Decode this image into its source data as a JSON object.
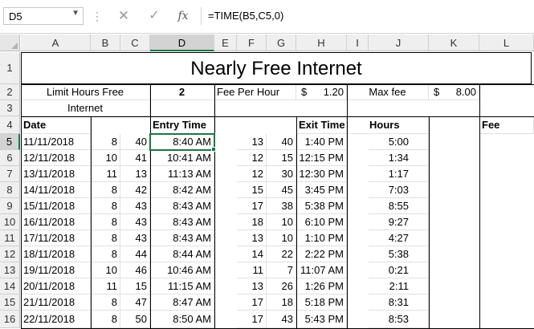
{
  "formula_bar": {
    "name_box": "D5",
    "cancel_icon": "✕",
    "enter_icon": "✓",
    "fx_label": "fx",
    "formula": "=TIME(B5,C5,0)"
  },
  "columns": [
    "A",
    "B",
    "C",
    "D",
    "E",
    "F",
    "G",
    "H",
    "I",
    "J",
    "K",
    "L"
  ],
  "selected_column": "D",
  "selected_row": "5",
  "rows": [
    "1",
    "2",
    "3",
    "4",
    "5",
    "6",
    "7",
    "8",
    "9",
    "10",
    "11",
    "12",
    "13",
    "14",
    "15",
    "16"
  ],
  "title": "Nearly Free Internet",
  "params": {
    "limit_label_1": "Limit Hours Free",
    "limit_label_2": "Internet",
    "limit_value": "2",
    "fee_label": "Fee Per Hour",
    "fee_currency": "$",
    "fee_value": "1.20",
    "max_label": "Max fee",
    "max_currency": "$",
    "max_value": "8.00"
  },
  "headers": {
    "date": "Date",
    "entry": "Entry Time",
    "exit": "Exit Time",
    "hours": "Hours",
    "fee": "Fee"
  },
  "data_rows": [
    {
      "date": "11/11/2018",
      "b": "8",
      "c": "40",
      "entry": "8:40 AM",
      "f": "13",
      "g": "40",
      "exit": "1:40 PM",
      "hours": "5:00"
    },
    {
      "date": "12/11/2018",
      "b": "10",
      "c": "41",
      "entry": "10:41 AM",
      "f": "12",
      "g": "15",
      "exit": "12:15 PM",
      "hours": "1:34"
    },
    {
      "date": "13/11/2018",
      "b": "11",
      "c": "13",
      "entry": "11:13 AM",
      "f": "12",
      "g": "30",
      "exit": "12:30 PM",
      "hours": "1:17"
    },
    {
      "date": "14/11/2018",
      "b": "8",
      "c": "42",
      "entry": "8:42 AM",
      "f": "15",
      "g": "45",
      "exit": "3:45 PM",
      "hours": "7:03"
    },
    {
      "date": "15/11/2018",
      "b": "8",
      "c": "43",
      "entry": "8:43 AM",
      "f": "17",
      "g": "38",
      "exit": "5:38 PM",
      "hours": "8:55"
    },
    {
      "date": "16/11/2018",
      "b": "8",
      "c": "43",
      "entry": "8:43 AM",
      "f": "18",
      "g": "10",
      "exit": "6:10 PM",
      "hours": "9:27"
    },
    {
      "date": "17/11/2018",
      "b": "8",
      "c": "43",
      "entry": "8:43 AM",
      "f": "13",
      "g": "10",
      "exit": "1:10 PM",
      "hours": "4:27"
    },
    {
      "date": "18/11/2018",
      "b": "8",
      "c": "44",
      "entry": "8:44 AM",
      "f": "14",
      "g": "22",
      "exit": "2:22 PM",
      "hours": "5:38"
    },
    {
      "date": "19/11/2018",
      "b": "10",
      "c": "46",
      "entry": "10:46 AM",
      "f": "11",
      "g": "7",
      "exit": "11:07 AM",
      "hours": "0:21"
    },
    {
      "date": "20/11/2018",
      "b": "11",
      "c": "15",
      "entry": "11:15 AM",
      "f": "13",
      "g": "26",
      "exit": "1:26 PM",
      "hours": "2:11"
    },
    {
      "date": "21/11/2018",
      "b": "8",
      "c": "47",
      "entry": "8:47 AM",
      "f": "17",
      "g": "18",
      "exit": "5:18 PM",
      "hours": "8:31"
    },
    {
      "date": "22/11/2018",
      "b": "8",
      "c": "50",
      "entry": "8:50 AM",
      "f": "17",
      "g": "43",
      "exit": "5:43 PM",
      "hours": "8:53"
    }
  ]
}
